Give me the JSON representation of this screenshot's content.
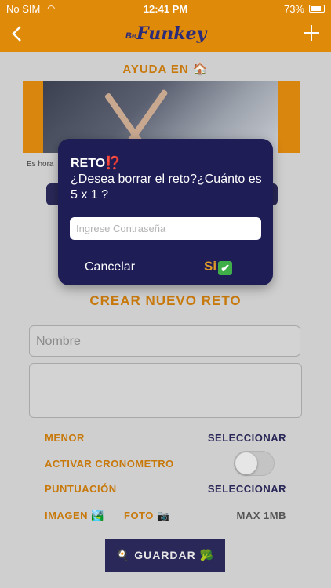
{
  "status_bar": {
    "carrier": "No SIM",
    "time": "12:41 PM",
    "battery": "73%"
  },
  "nav": {
    "logo_prefix": "Be",
    "logo_text": "Funkey"
  },
  "help": {
    "heading": "AYUDA EN 🏠",
    "caption": "Es hora"
  },
  "form": {
    "title": "CREAR NUEVO RETO",
    "name_placeholder": "Nombre",
    "menor_label": "MENOR",
    "menor_action": "SELECCIONAR",
    "crono_label": "ACTIVAR CRONOMETRO",
    "puntuacion_label": "PUNTUACIÓN",
    "puntuacion_action": "SELECCIONAR",
    "imagen_label": "IMAGEN 🏞️",
    "foto_label": "FOTO 📷",
    "max_label": "MAX 1MB",
    "save_label": "🍳 GUARDAR 🥦"
  },
  "dialog": {
    "title": "RETO⁉️",
    "message": "¿Desea borrar el reto?¿Cuánto es 5 x 1 ?",
    "password_placeholder": "Ingrese Contraseña",
    "cancel_label": "Cancelar",
    "confirm_label": "Si",
    "confirm_icon": "✔"
  },
  "colors": {
    "accent": "#e08a0a",
    "navy": "#1f1d56"
  }
}
